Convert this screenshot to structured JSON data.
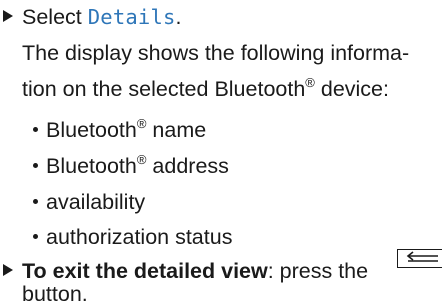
{
  "steps": {
    "select": {
      "prefix": "Select ",
      "item": "Details",
      "suffix": "."
    },
    "description": {
      "line1": "The display shows the following informa-",
      "line2_pre": "tion on the selected Bluetooth",
      "line2_reg": "®",
      "line2_post": " device:"
    },
    "bullets": [
      {
        "text": "Bluetooth",
        "reg": "®",
        "suffix": " name"
      },
      {
        "text": "Bluetooth",
        "reg": "®",
        "suffix": " address"
      },
      {
        "text": "availability"
      },
      {
        "text": "authorization status"
      }
    ],
    "exit": {
      "bold": "To exit the detailed view",
      "rest": ": press the",
      "button_icon": "back-arrow-icon",
      "line2": "button."
    }
  }
}
